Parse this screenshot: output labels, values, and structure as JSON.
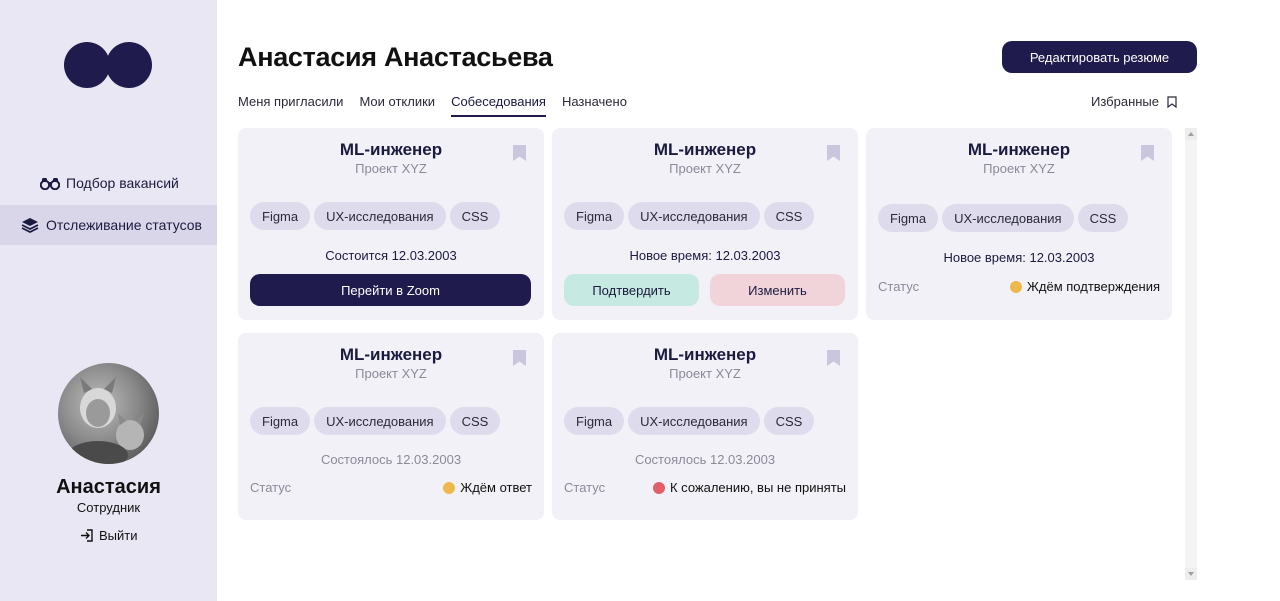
{
  "sidebar": {
    "nav": [
      {
        "label": "Подбор вакансий",
        "icon": "binoculars-icon"
      },
      {
        "label": "Отслеживание статусов",
        "icon": "layers-icon"
      }
    ],
    "user": {
      "name": "Анастасия",
      "role": "Сотрудник"
    },
    "logout_label": "Выйти"
  },
  "header": {
    "title": "Анастасия Анастасьева",
    "edit_button": "Редактировать резюме",
    "tabs": [
      "Меня пригласили",
      "Мои отклики",
      "Собеседования",
      "Назначено"
    ],
    "active_tab": "Собеседования",
    "favorites_label": "Избранные"
  },
  "colors": {
    "primary": "#1f1b4d",
    "waiting": "#edb94a",
    "rejected": "#e0606a",
    "confirm_bg": "#c6e9e1",
    "change_bg": "#f1d4d9"
  },
  "cards": [
    {
      "title": "ML-инженер",
      "project": "Проект XYZ",
      "tags": [
        "Figma",
        "UX-исследования",
        "CSS"
      ],
      "date_text": "Состоится 12.03.2003",
      "action": "Перейти в Zoom"
    },
    {
      "title": "ML-инженер",
      "project": "Проект XYZ",
      "tags": [
        "Figma",
        "UX-исследования",
        "CSS"
      ],
      "date_text": "Новое время: 12.03.2003",
      "confirm": "Подтвердить",
      "change": "Изменить"
    },
    {
      "title": "ML-инженер",
      "project": "Проект XYZ",
      "tags": [
        "Figma",
        "UX-исследования",
        "CSS"
      ],
      "date_text": "Новое время: 12.03.2003",
      "status_label": "Статус",
      "status": "Ждём подтверждения"
    },
    {
      "title": "ML-инженер",
      "project": "Проект XYZ",
      "tags": [
        "Figma",
        "UX-исследования",
        "CSS"
      ],
      "date_text": "Состоялось 12.03.2003",
      "status_label": "Статус",
      "status": "Ждём ответ"
    },
    {
      "title": "ML-инженер",
      "project": "Проект XYZ",
      "tags": [
        "Figma",
        "UX-исследования",
        "CSS"
      ],
      "date_text": "Состоялось 12.03.2003",
      "status_label": "Статус",
      "status": "К сожалению, вы не приняты"
    }
  ]
}
